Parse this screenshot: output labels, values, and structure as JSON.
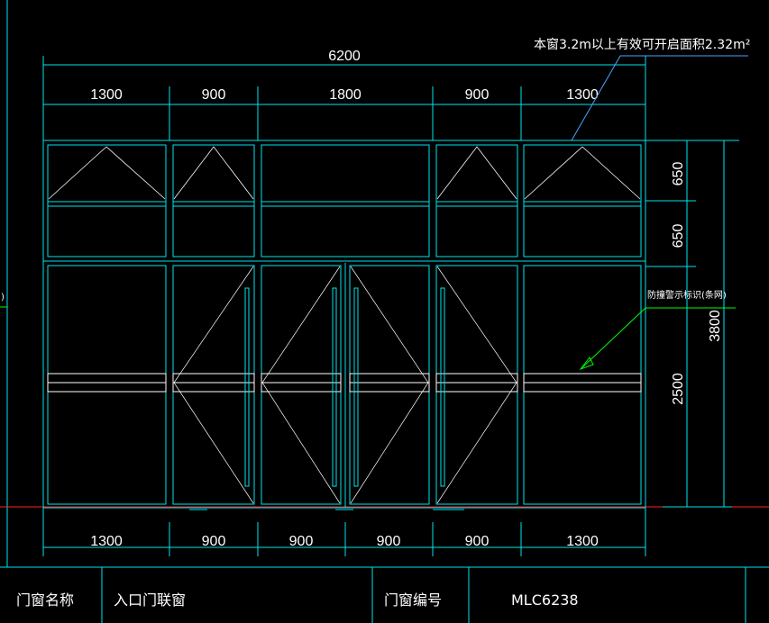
{
  "colors": {
    "background": "#000000",
    "frame": "#00e5ee",
    "dimension": "#00ffff",
    "opening": "#ffffff",
    "leader_blue": "#4aa3ff",
    "leader_green": "#00ff00",
    "ground": "#ff2020",
    "text": "#ffffff"
  },
  "top_dimensions": {
    "overall": "6200",
    "segments": [
      "1300",
      "900",
      "1800",
      "900",
      "1300"
    ]
  },
  "bottom_dimensions": {
    "segments": [
      "1300",
      "900",
      "900",
      "900",
      "900",
      "1300"
    ]
  },
  "right_dimensions": {
    "upper": [
      "650",
      "650"
    ],
    "lower": "2500",
    "overall": "3800"
  },
  "annotations": {
    "opening_area_note": "本窗3.2m以上有效可开启面积2.32m²",
    "warning_mark_note": "防撞警示标识(条网)",
    "left_edge_mark": ")"
  },
  "title_block": {
    "name_label": "门窗名称",
    "name_value": "入口门联窗",
    "number_label": "门窗编号",
    "number_value": "MLC6238"
  }
}
